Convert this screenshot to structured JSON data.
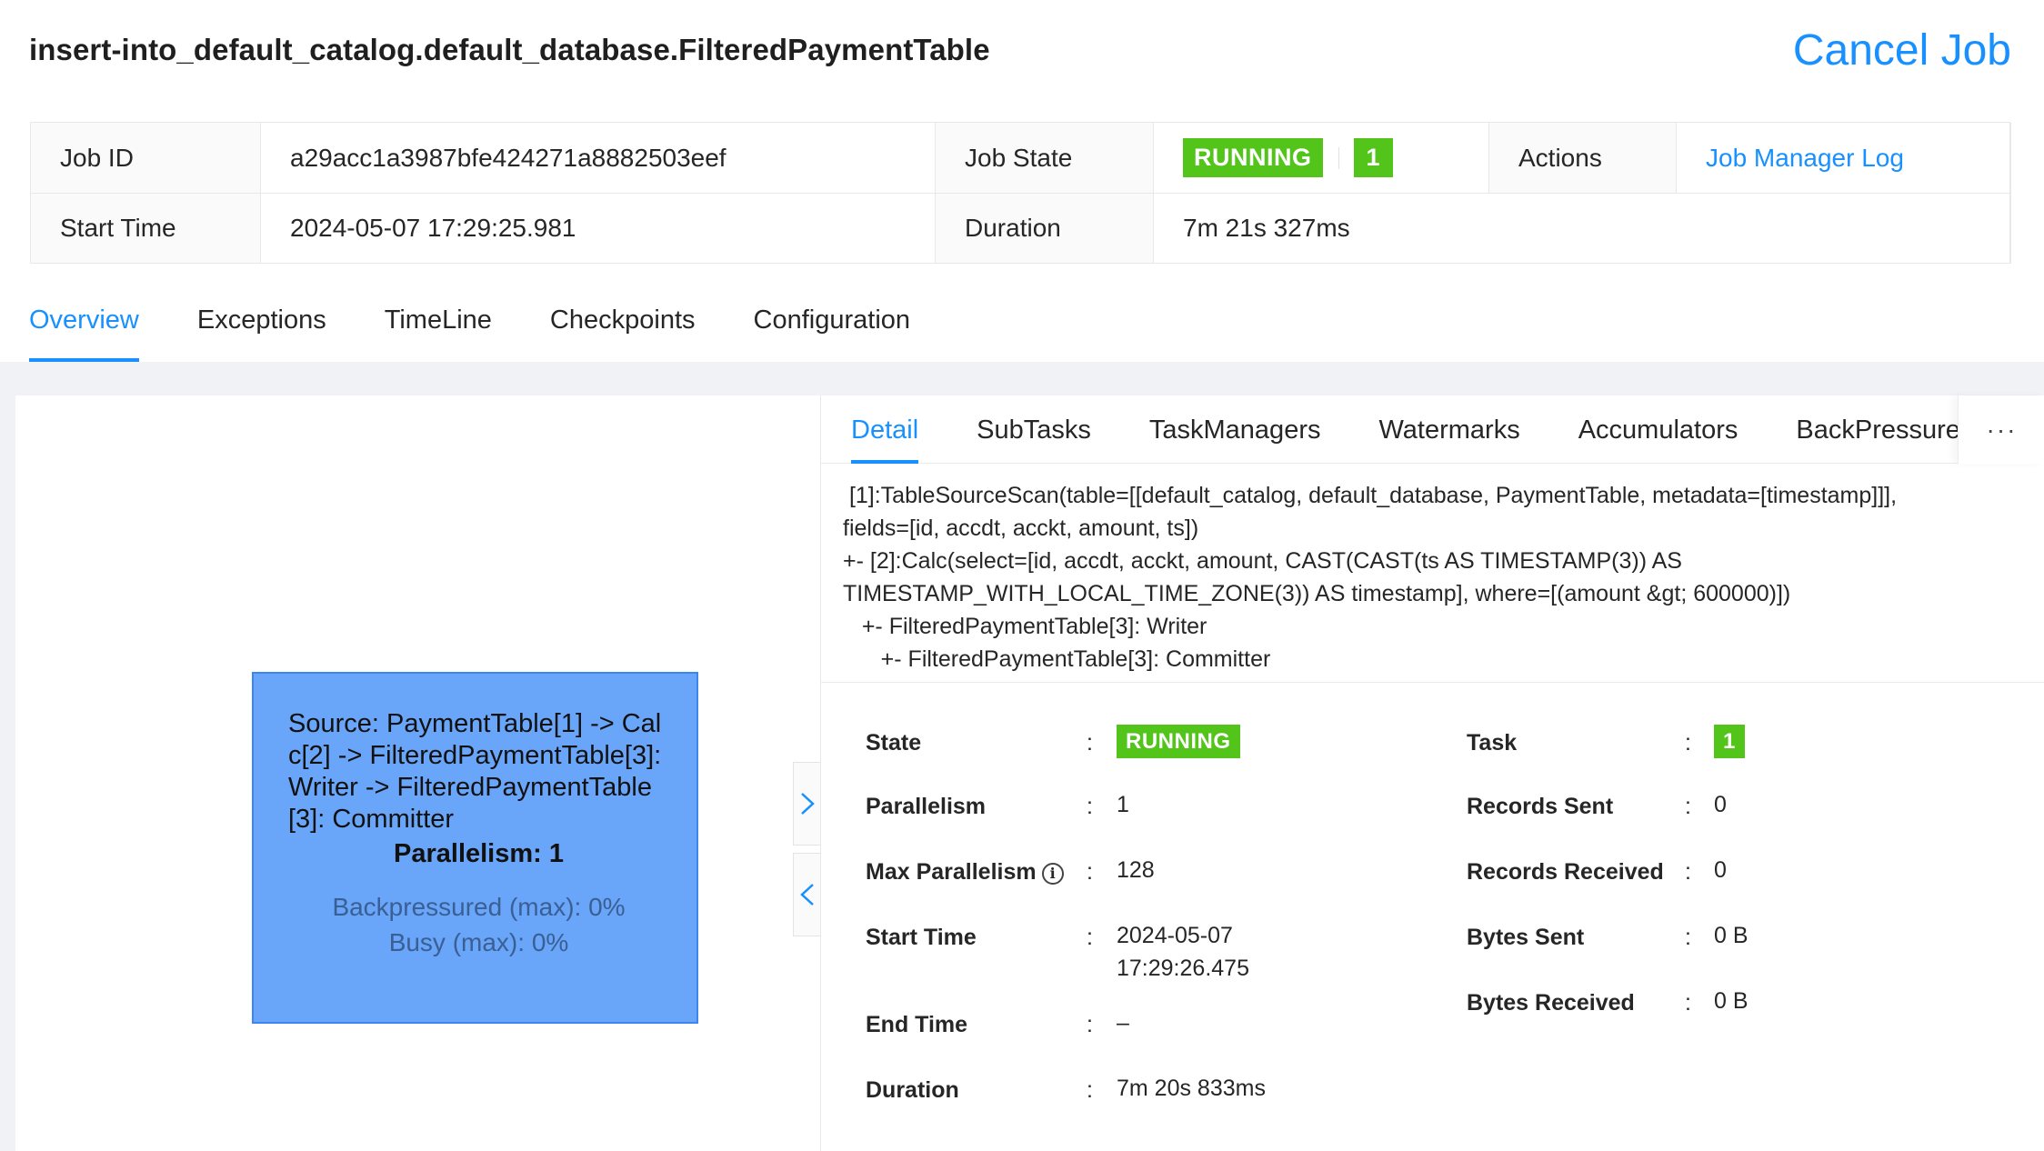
{
  "header": {
    "title": "insert-into_default_catalog.default_database.FilteredPaymentTable",
    "cancel_label": "Cancel Job"
  },
  "info": {
    "job_id_label": "Job ID",
    "job_id": "a29acc1a3987bfe424271a8882503eef",
    "job_state_label": "Job State",
    "job_state": "RUNNING",
    "job_state_count": "1",
    "actions_label": "Actions",
    "actions_link": "Job Manager Log",
    "start_time_label": "Start Time",
    "start_time": "2024-05-07 17:29:25.981",
    "duration_label": "Duration",
    "duration": "7m 21s 327ms"
  },
  "main_tabs": [
    {
      "label": "Overview",
      "active": true
    },
    {
      "label": "Exceptions"
    },
    {
      "label": "TimeLine"
    },
    {
      "label": "Checkpoints"
    },
    {
      "label": "Configuration"
    }
  ],
  "graph": {
    "node_name": "Source: PaymentTable[1] -> Calc[2] -> FilteredPaymentTable[3]: Writer -> FilteredPaymentTable[3]: Committer",
    "node_parallelism": "Parallelism: 1",
    "node_backpressured": "Backpressured (max): 0%",
    "node_busy": "Busy (max): 0%",
    "expand_icon": "chevron-right",
    "collapse_icon": "chevron-left"
  },
  "detail": {
    "tabs": [
      "Detail",
      "SubTasks",
      "TaskManagers",
      "Watermarks",
      "Accumulators",
      "BackPressure"
    ],
    "more_label": "···",
    "plan_lines": [
      " [1]:TableSourceScan(table=[[default_catalog, default_database, PaymentTable, metadata=[timestamp]]],",
      "fields=[id, accdt, acckt, amount, ts])",
      "+- [2]:Calc(select=[id, accdt, acckt, amount, CAST(CAST(ts AS TIMESTAMP(3)) AS",
      "TIMESTAMP_WITH_LOCAL_TIME_ZONE(3)) AS timestamp], where=[(amount &gt; 600000)])",
      "   +- FilteredPaymentTable[3]: Writer",
      "      +- FilteredPaymentTable[3]: Committer"
    ],
    "fields": {
      "state_label": "State",
      "state": "RUNNING",
      "parallelism_label": "Parallelism",
      "parallelism": "1",
      "max_parallelism_label": "Max Parallelism",
      "max_parallelism": "128",
      "start_time_label": "Start Time",
      "start_time_date": "2024-05-07",
      "start_time_clock": "17:29:26.475",
      "end_time_label": "End Time",
      "end_time": "–",
      "duration_label": "Duration",
      "duration": "7m 20s 833ms",
      "task_label": "Task",
      "task": "1",
      "records_sent_label": "Records Sent",
      "records_sent": "0",
      "records_received_label": "Records Received",
      "records_received": "0",
      "bytes_sent_label": "Bytes Sent",
      "bytes_sent": "0 B",
      "bytes_received_label": "Bytes Received",
      "bytes_received": "0 B",
      "colon": ":"
    }
  },
  "colors": {
    "accent": "#1890ff",
    "running": "#52c41a",
    "node": "#69a5f8"
  }
}
